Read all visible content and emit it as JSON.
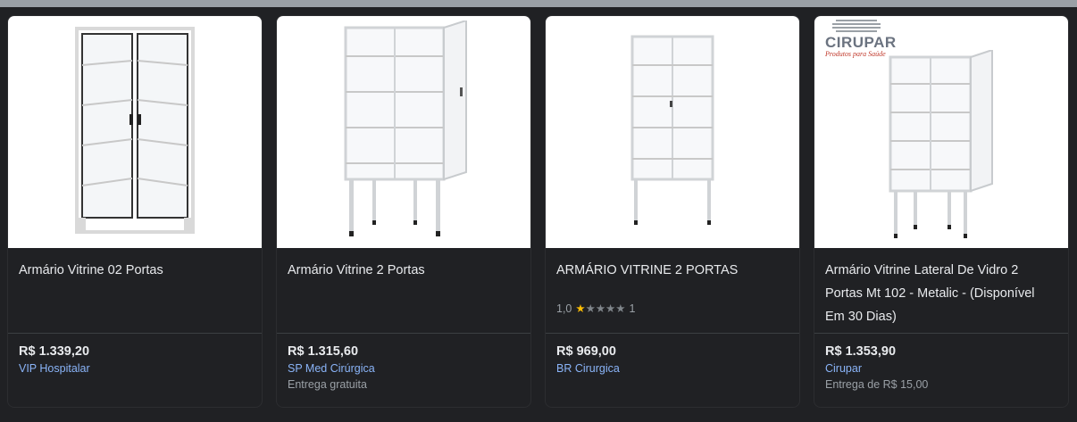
{
  "products": [
    {
      "title": "Armário Vitrine 02 Portas",
      "price": "R$ 1.339,20",
      "seller": "VIP Hospitalar",
      "shipping": "",
      "rating": null,
      "image_alt": "glass-cabinet-two-doors-closed"
    },
    {
      "title": "Armário Vitrine 2 Portas",
      "price": "R$ 1.315,60",
      "seller": "SP Med Cirúrgica",
      "shipping": "Entrega gratuita",
      "rating": null,
      "image_alt": "glass-cabinet-door-open"
    },
    {
      "title": "ARMÁRIO VITRINE 2 PORTAS",
      "price": "R$ 969,00",
      "seller": "BR Cirurgica",
      "shipping": "",
      "rating": {
        "score": "1,0",
        "stars_filled": 1,
        "stars_total": 5,
        "count": "1"
      },
      "image_alt": "glass-cabinet-closed"
    },
    {
      "title": "Armário Vitrine Lateral De Vidro 2 Portas Mt 102 - Metalic - (Disponível Em 30 Dias)",
      "price": "R$ 1.353,90",
      "seller": "Cirupar",
      "shipping": "Entrega de R$ 15,00",
      "rating": null,
      "image_alt": "glass-cabinet-door-open-with-logo",
      "logo": {
        "text": "CIRUPAR",
        "tagline": "Produtos para Saúde"
      }
    }
  ],
  "colors": {
    "background": "#202124",
    "title_text": "#e8eaed",
    "seller_link": "#8ab4f8",
    "muted_text": "#9aa0a6",
    "star_filled": "#fbbc04"
  }
}
